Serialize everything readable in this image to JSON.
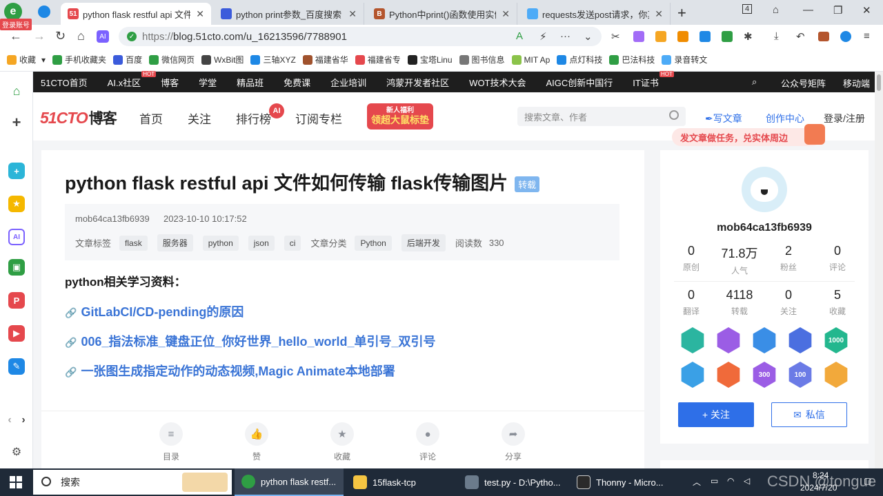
{
  "browser": {
    "login_badge": "登录账号",
    "tabs": [
      {
        "label": "python flask restful api 文件",
        "favicon": "51",
        "active": true
      },
      {
        "label": "python print参数_百度搜索",
        "favicon": "baidu-paw"
      },
      {
        "label": "Python中print()函数使用实例",
        "favicon": "B"
      },
      {
        "label": "requests发送post请求，你真",
        "favicon": "cloud"
      }
    ],
    "tab_count": "4",
    "url_prefix": "https://",
    "url_rest": "blog.51cto.com/u_16213596/7788901"
  },
  "bookmarks": [
    {
      "label": "收藏",
      "color": "#f5a623"
    },
    {
      "label": "手机收藏夹",
      "color": "#2f9e44"
    },
    {
      "label": "百度",
      "color": "#3b5bdb"
    },
    {
      "label": "微信网页",
      "color": "#2f9e44"
    },
    {
      "label": "WxBit图",
      "color": "#444444"
    },
    {
      "label": "三轴XYZ",
      "color": "#1e88e5"
    },
    {
      "label": "福建省华",
      "color": "#a0522d"
    },
    {
      "label": "福建省专",
      "color": "#e5484d"
    },
    {
      "label": "宝塔Linu",
      "color": "#222222"
    },
    {
      "label": "图书信息",
      "color": "#777777"
    },
    {
      "label": "MIT Ap",
      "color": "#8bc34a"
    },
    {
      "label": "点灯科技",
      "color": "#1e88e5"
    },
    {
      "label": "巴法科技",
      "color": "#2f9e44"
    },
    {
      "label": "录音转文",
      "color": "#4dabf7"
    }
  ],
  "site_nav": {
    "items": [
      {
        "label": "51CTO首页"
      },
      {
        "label": "AI.x社区",
        "hot": "HOT"
      },
      {
        "label": "博客"
      },
      {
        "label": "学堂"
      },
      {
        "label": "精品班"
      },
      {
        "label": "免费课"
      },
      {
        "label": "企业培训"
      },
      {
        "label": "鸿蒙开发者社区"
      },
      {
        "label": "WOT技术大会"
      },
      {
        "label": "AIGC创新中国行"
      },
      {
        "label": "IT证书",
        "hot": "HOT"
      }
    ],
    "right_items": [
      "公众号矩阵",
      "移动端"
    ]
  },
  "header": {
    "logo_main": "51CTO",
    "logo_blog": "博客",
    "nav": [
      "首页",
      "关注",
      "排行榜",
      "订阅专栏"
    ],
    "ai_badge": "AI",
    "promo_top": "新人福利",
    "promo_main": "领超大鼠标垫",
    "search_placeholder": "搜索文章、作者",
    "write_label": "写文章",
    "center_label": "创作中心",
    "login_label": "登录/注册",
    "task_banner": "发文章做任务，兑实体周边"
  },
  "article": {
    "title": "python flask restful api 文件如何传输 flask传输图片",
    "repost_tag": "转载",
    "author": "mob64ca13fb6939",
    "date": "2023-10-10 10:17:52",
    "tags_label": "文章标签",
    "tags": [
      "flask",
      "服务器",
      "python",
      "json",
      "ci"
    ],
    "category_label": "文章分类",
    "categories": [
      "Python",
      "后端开发"
    ],
    "reads_label": "阅读数",
    "reads": "330",
    "subhead": "python相关学习资料：",
    "related_links": [
      "GitLabCI/CD-pending的原因",
      "006_指法标准_键盘正位_你好世界_hello_world_单引号_双引号",
      "一张图生成指定动作的动态视频,Magic Animate本地部署"
    ],
    "actions": [
      "目录",
      "赞",
      "收藏",
      "评论",
      "分享"
    ]
  },
  "profile": {
    "name": "mob64ca13fb6939",
    "stats_row1": [
      {
        "value": "0",
        "label": "原创"
      },
      {
        "value": "71.8万",
        "label": "人气"
      },
      {
        "value": "2",
        "label": "粉丝"
      },
      {
        "value": "0",
        "label": "评论"
      }
    ],
    "stats_row2": [
      {
        "value": "0",
        "label": "翻译"
      },
      {
        "value": "4118",
        "label": "转载"
      },
      {
        "value": "0",
        "label": "关注"
      },
      {
        "value": "5",
        "label": "收藏"
      }
    ],
    "badges": [
      {
        "color": "#2bb5a0",
        "text": ""
      },
      {
        "color": "#9b5de5",
        "text": ""
      },
      {
        "color": "#3a8ee6",
        "text": ""
      },
      {
        "color": "#4b6fe0",
        "text": ""
      },
      {
        "color": "#23b78e",
        "text": "1000"
      },
      {
        "color": "#3aa0e6",
        "text": ""
      },
      {
        "color": "#f06a3a",
        "text": ""
      },
      {
        "color": "#9b5de5",
        "text": "300"
      },
      {
        "color": "#6b7be6",
        "text": "100"
      },
      {
        "color": "#f2a93b",
        "text": ""
      }
    ],
    "follow_label": "+ 关注",
    "message_label": "私信"
  },
  "taskbar": {
    "search_label": "搜索",
    "apps": [
      {
        "label": "python flask restf...",
        "color": "#2f9e44",
        "active": true
      },
      {
        "label": "15flask-tcp",
        "color": "#f5c542"
      },
      {
        "label": "test.py - D:\\Pytho...",
        "color": "#6b7b8c"
      },
      {
        "label": "Thonny - Micro...",
        "color": "#2a2a2a"
      }
    ],
    "time": "8:24",
    "date": "2024/7/20",
    "watermark": "CSDN @tongue"
  }
}
